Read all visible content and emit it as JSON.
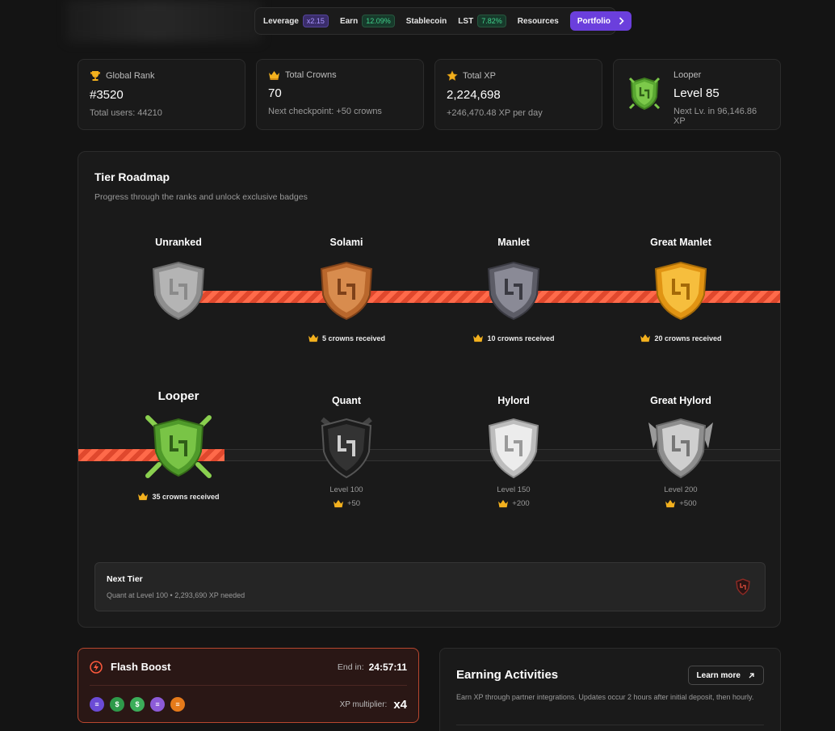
{
  "nav": {
    "items": [
      {
        "label": "Leverage",
        "pill": "x2.15",
        "pill_color": "purple"
      },
      {
        "label": "Earn",
        "pill": "12.09%",
        "pill_color": "green"
      },
      {
        "label": "Stablecoin",
        "pill": "",
        "pill_color": ""
      },
      {
        "label": "LST",
        "pill": "7.82%",
        "pill_color": "green"
      },
      {
        "label": "Resources",
        "pill": "",
        "pill_color": ""
      }
    ],
    "portfolio_label": "Portfolio",
    "portfolio_icon": "chevron-right-icon"
  },
  "stats": {
    "global_rank": {
      "label": "Global Rank",
      "value": "#3520",
      "sub": "Total users: 44210",
      "icon": "trophy-icon"
    },
    "total_crowns": {
      "label": "Total Crowns",
      "value": "70",
      "sub": "Next checkpoint: +50 crowns",
      "icon": "crown-icon"
    },
    "total_xp": {
      "label": "Total XP",
      "value": "2,224,698",
      "sub": "+246,470.48 XP per day",
      "icon": "star-icon"
    },
    "tier": {
      "label": "Looper",
      "value": "Level 85",
      "sub": "Next Lv. in 96,146.86 XP",
      "icon": "looper-badge-icon"
    }
  },
  "roadmap": {
    "title": "Tier Roadmap",
    "subtitle": "Progress through the ranks and unlock exclusive badges",
    "tiers_row1": [
      {
        "name": "Unranked",
        "crowns": "",
        "color": "#a8a8a8"
      },
      {
        "name": "Solami",
        "crowns": "5 crowns received",
        "color": "#c77a3d"
      },
      {
        "name": "Manlet",
        "crowns": "10 crowns received",
        "color": "#7a7a86"
      },
      {
        "name": "Great Manlet",
        "crowns": "20 crowns received",
        "color": "#e9a21f"
      }
    ],
    "tiers_row2": [
      {
        "name": "Looper",
        "crowns": "35 crowns received",
        "level": "",
        "bonus": "",
        "color": "#6fbf3a"
      },
      {
        "name": "Quant",
        "crowns": "",
        "level": "Level 100",
        "bonus": "+50",
        "color": "#2a2a2a"
      },
      {
        "name": "Hylord",
        "crowns": "",
        "level": "Level 150",
        "bonus": "+200",
        "color": "#d6d6d6"
      },
      {
        "name": "Great Hylord",
        "crowns": "",
        "level": "Level 200",
        "bonus": "+500",
        "color": "#bdbdbd"
      }
    ],
    "next_tier": {
      "title": "Next Tier",
      "sub": "Quant at Level 100 • 2,293,690 XP needed",
      "icon": "quant-badge-icon"
    }
  },
  "flash_boost": {
    "title": "Flash Boost",
    "end_label": "End in:",
    "timer": "24:57:11",
    "multiplier_label": "XP multiplier:",
    "multiplier": "x4",
    "icon": "lightning-icon",
    "tokens": [
      {
        "name": "token-icon-1",
        "color": "#6b4bd6"
      },
      {
        "name": "token-icon-2",
        "color": "#2e9a4a"
      },
      {
        "name": "token-icon-3",
        "color": "#3cae5a"
      },
      {
        "name": "token-icon-4",
        "color": "#8c5bd8"
      },
      {
        "name": "token-icon-5",
        "color": "#e67a1a"
      }
    ]
  },
  "earning": {
    "title": "Earning Activities",
    "learn_more": "Learn more",
    "description": "Earn XP through partner integrations. Updates occur 2 hours after initial deposit, then hourly."
  }
}
